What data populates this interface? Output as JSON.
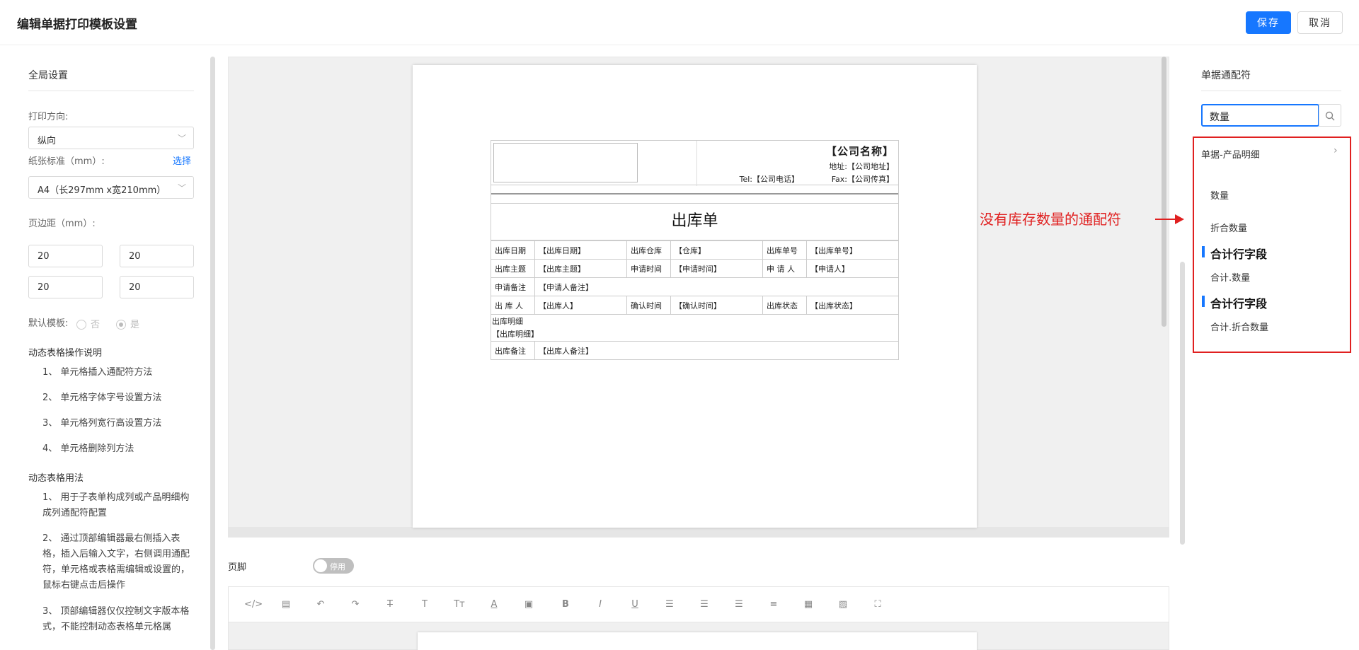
{
  "header": {
    "title": "编辑单据打印模板设置",
    "save": "保存",
    "cancel": "取消"
  },
  "left": {
    "global_title": "全局设置",
    "orient_label": "打印方向:",
    "orient_value": "纵向",
    "paper_label": "纸张标准（mm）:",
    "paper_link": "选择",
    "paper_value": "A4（长297mm x宽210mm）",
    "margin_label": "页边距（mm）:",
    "margins": [
      "20",
      "20",
      "20",
      "20"
    ],
    "default_label": "默认模板:",
    "default_no": "否",
    "default_yes": "是",
    "ops_title": "动态表格操作说明",
    "ops_items": [
      "1、 单元格插入通配符方法",
      "2、 单元格字体字号设置方法",
      "3、 单元格列宽行高设置方法",
      "4、 单元格删除列方法"
    ],
    "usage_title": "动态表格用法",
    "usage_items": [
      "1、 用于子表单构成列或产品明细构成列通配符配置",
      "2、 通过顶部编辑器最右侧插入表格，插入后输入文字，右侧调用通配符，单元格或表格需编辑或设置的，鼠标右键点击后操作",
      "3、 顶部编辑器仅仅控制文字版本格式，不能控制动态表格单元格属"
    ]
  },
  "doc": {
    "company_name": "【公司名称】",
    "address": "地址:【公司地址】",
    "tel": "Tel:【公司电话】",
    "fax": "Fax:【公司传真】",
    "title": "出库单",
    "rows": [
      [
        "出库日期",
        "【出库日期】",
        "出库仓库",
        "【仓库】",
        "出库单号",
        "【出库单号】"
      ],
      [
        "出库主题",
        "【出库主题】",
        "申请时间",
        "【申请时间】",
        "申 请 人",
        "【申请人】"
      ],
      [
        "出 库 人",
        "【出库人】",
        "确认时间",
        "【确认时间】",
        "出库状态",
        "【出库状态】"
      ]
    ],
    "note_label": "申请备注",
    "note_value": "【申请人备注】",
    "detail_label": "出库明细",
    "detail_value": "【出库明细】",
    "out_note_label": "出库备注",
    "out_note_value": "【出库人备注】"
  },
  "footer": {
    "label": "页脚",
    "toggle": "停用"
  },
  "toolbar_icons": [
    "code-icon",
    "template-icon",
    "undo-icon",
    "redo-icon",
    "strikethrough-icon",
    "text-icon",
    "font-size-icon",
    "font-color-icon",
    "background-color-icon",
    "bold-icon",
    "italic-icon",
    "underline-icon",
    "align-left-icon",
    "align-center-icon",
    "align-right-icon",
    "justify-icon",
    "table-icon",
    "image-icon",
    "fullscreen-icon"
  ],
  "right": {
    "title": "单据通配符",
    "search_value": "数量",
    "category": "单据-产品明细",
    "items": [
      "数量",
      "折合数量"
    ],
    "section1": "合计行字段",
    "sum1": "合计.数量",
    "section2": "合计行字段",
    "sum2": "合计.折合数量",
    "annotation": "没有库存数量的通配符"
  },
  "colors": {
    "primary": "#1677ff",
    "annotation": "#e02020"
  }
}
